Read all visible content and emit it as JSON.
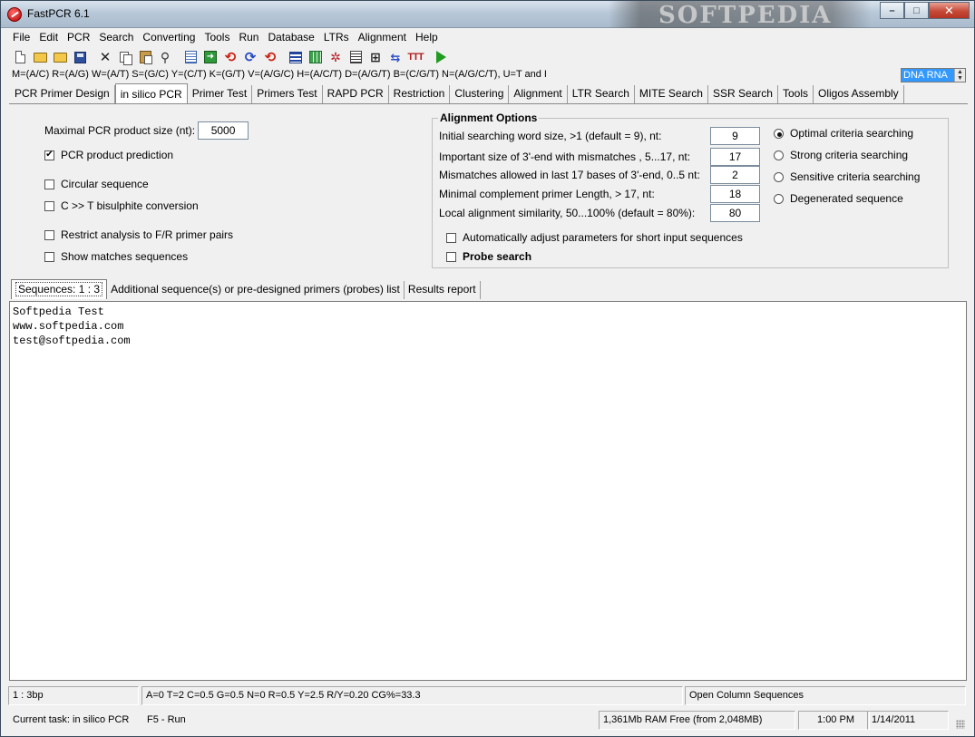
{
  "window": {
    "title": "FastPCR 6.1",
    "watermark": "SOFTPEDIA",
    "controls": {
      "minimize": "–",
      "maximize": "□",
      "close": "✕"
    }
  },
  "menu": [
    {
      "label": "File"
    },
    {
      "label": "Edit"
    },
    {
      "label": "PCR"
    },
    {
      "label": "Search"
    },
    {
      "label": "Converting"
    },
    {
      "label": "Tools"
    },
    {
      "label": "Run"
    },
    {
      "label": "Database"
    },
    {
      "label": "LTRs"
    },
    {
      "label": "Alignment"
    },
    {
      "label": "Help"
    }
  ],
  "toolbar_icons": [
    "new-document-icon",
    "open-folder-icon",
    "open-recent-icon",
    "save-icon",
    "delete-icon",
    "copy-icon",
    "paste-icon",
    "find-icon",
    "list-icon",
    "export-icon",
    "cycle-red-icon",
    "cycle-blue-icon",
    "cycle-red-2-icon",
    "bars-icon",
    "grid-icon",
    "molecule-icon",
    "page-icon",
    "plus-icon",
    "arrows-icon",
    "ttt-icon",
    "run-icon"
  ],
  "codes_line": "M=(A/C) R=(A/G) W=(A/T) S=(G/C) Y=(C/T) K=(G/T) V=(A/G/C) H=(A/C/T) D=(A/G/T) B=(C/G/T) N=(A/G/C/T), U=T and I",
  "sequence_type": {
    "selected": "DNA RNA"
  },
  "main_tabs": [
    {
      "label": "PCR Primer Design"
    },
    {
      "label": "in silico PCR",
      "active": true
    },
    {
      "label": "Primer Test"
    },
    {
      "label": "Primers Test"
    },
    {
      "label": "RAPD PCR"
    },
    {
      "label": "Restriction"
    },
    {
      "label": "Clustering"
    },
    {
      "label": "Alignment"
    },
    {
      "label": "LTR Search"
    },
    {
      "label": "MITE Search"
    },
    {
      "label": "SSR Search"
    },
    {
      "label": "Tools"
    },
    {
      "label": "Oligos Assembly"
    }
  ],
  "left_panel": {
    "max_product": {
      "label": "Maximal PCR product size (nt):",
      "value": "5000"
    },
    "checks": [
      {
        "label": "PCR product prediction",
        "checked": true
      },
      {
        "label": "Circular sequence",
        "checked": false
      },
      {
        "label": "C >> T bisulphite conversion",
        "checked": false
      },
      {
        "label": "Restrict analysis to F/R primer pairs",
        "checked": false
      },
      {
        "label": "Show matches sequences",
        "checked": false
      }
    ]
  },
  "alignment_options": {
    "title": "Alignment Options",
    "fields": [
      {
        "label": "Initial searching word size, >1 (default = 9), nt:",
        "value": "9"
      },
      {
        "label": "Important size of 3'-end with mismatches , 5...17, nt:",
        "value": "17"
      },
      {
        "label": "Mismatches allowed in last 17 bases of 3'-end, 0..5 nt:",
        "value": "2"
      },
      {
        "label": "Minimal complement primer Length, > 17, nt:",
        "value": "18"
      },
      {
        "label": "Local alignment similarity, 50...100% (default = 80%):",
        "value": "80"
      }
    ],
    "radios": [
      {
        "label": "Optimal criteria searching",
        "selected": true
      },
      {
        "label": "Strong criteria searching",
        "selected": false
      },
      {
        "label": "Sensitive criteria searching",
        "selected": false
      },
      {
        "label": "Degenerated sequence",
        "selected": false
      }
    ],
    "auto_adjust": {
      "label": "Automatically adjust parameters for short input sequences",
      "checked": false
    },
    "probe_search": {
      "label": "Probe search",
      "checked": false
    }
  },
  "sub_tabs": [
    {
      "label": "Sequences: 1 : 3",
      "active": true
    },
    {
      "label": "Additional sequence(s) or pre-designed primers (probes) list"
    },
    {
      "label": "Results report"
    }
  ],
  "editor_lines": [
    "Softpedia Test",
    "www.softpedia.com",
    "test@softpedia.com"
  ],
  "status_bar_1": {
    "position": "1 : 3bp",
    "composition": "A=0 T=2 C=0.5 G=0.5 N=0 R=0.5 Y=2.5 R/Y=0.20 CG%=33.3",
    "info": "Open Column Sequences"
  },
  "status_bar_2": {
    "task": "Current task: in silico PCR",
    "hint": "F5 - Run",
    "memory": "1,361Mb RAM Free (from 2,048MB)",
    "time": "1:00 PM",
    "date": "1/14/2011"
  }
}
